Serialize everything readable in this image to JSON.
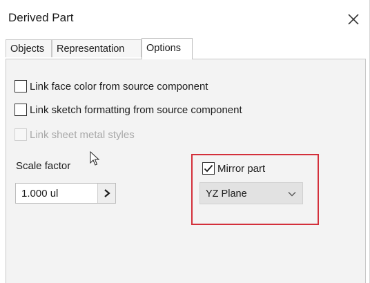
{
  "window": {
    "title": "Derived Part",
    "close_icon": "close-icon"
  },
  "tabs": [
    {
      "label": "Objects",
      "active": false
    },
    {
      "label": "Representation",
      "active": false
    },
    {
      "label": "Options",
      "active": true
    }
  ],
  "options": {
    "checkboxes": [
      {
        "label": "Link face color from source component",
        "checked": false,
        "enabled": true
      },
      {
        "label": "Link sketch formatting from source component",
        "checked": false,
        "enabled": true
      },
      {
        "label": "Link sheet metal styles",
        "checked": false,
        "enabled": false
      }
    ],
    "scale": {
      "label": "Scale factor",
      "value": "1.000 ul",
      "button_icon": "chevron-right-icon"
    },
    "mirror": {
      "label": "Mirror part",
      "checked": true,
      "plane": "YZ Plane",
      "dropdown_icon": "chevron-down-icon"
    }
  },
  "colors": {
    "highlight": "#d32f3a",
    "panel_background": "#f3f3f3",
    "disabled_text": "#a8a8a8"
  }
}
